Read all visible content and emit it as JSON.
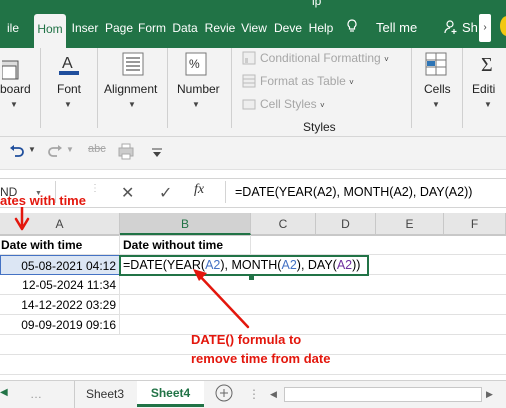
{
  "ribbon_tabs": [
    "ile",
    "Hom",
    "Inser",
    "Page",
    "Form",
    "Data",
    "Revie",
    "View",
    "Deve",
    "Help"
  ],
  "title_fragment": "lp",
  "tell_me": "Tell me",
  "share": "Sh",
  "groups": {
    "clipboard": "board",
    "font": "Font",
    "alignment": "Alignment",
    "number": "Number",
    "styles": "Styles",
    "cells": "Cells",
    "editing": "Editi"
  },
  "styles_cmds": [
    "Conditional Formatting",
    "Format as Table",
    "Cell Styles"
  ],
  "qat_text": "abc",
  "name_box": "ND",
  "fx": "fx",
  "formula": "=DATE(YEAR(A2), MONTH(A2), DAY(A2))",
  "columns": [
    "A",
    "B",
    "C",
    "D",
    "E",
    "F"
  ],
  "header_row": {
    "a": "Date with time",
    "b": "Date without time"
  },
  "rows": [
    {
      "a": "05-08-2021 04:12"
    },
    {
      "a": "12-05-2024 11:34"
    },
    {
      "a": "14-12-2022 03:29"
    },
    {
      "a": "09-09-2019 09:16"
    }
  ],
  "editing_formula": {
    "p1": "=DATE(YEAR(",
    "r1": "A2",
    "p2": "), MONTH(",
    "r2": "A2",
    "p3": "), DAY(",
    "r3": "A2",
    "p4": "))"
  },
  "annotation_top": "ates with time",
  "annotation_bottom_1": "DATE() formula to",
  "annotation_bottom_2": "remove time from date",
  "sheets": [
    "Sheet3",
    "Sheet4"
  ],
  "active_sheet": "Sheet4",
  "colors": {
    "excel_green": "#217346",
    "annotation_red": "#e3170d",
    "ref_blue": "#4472c4",
    "ref_purple": "#7030a0"
  }
}
